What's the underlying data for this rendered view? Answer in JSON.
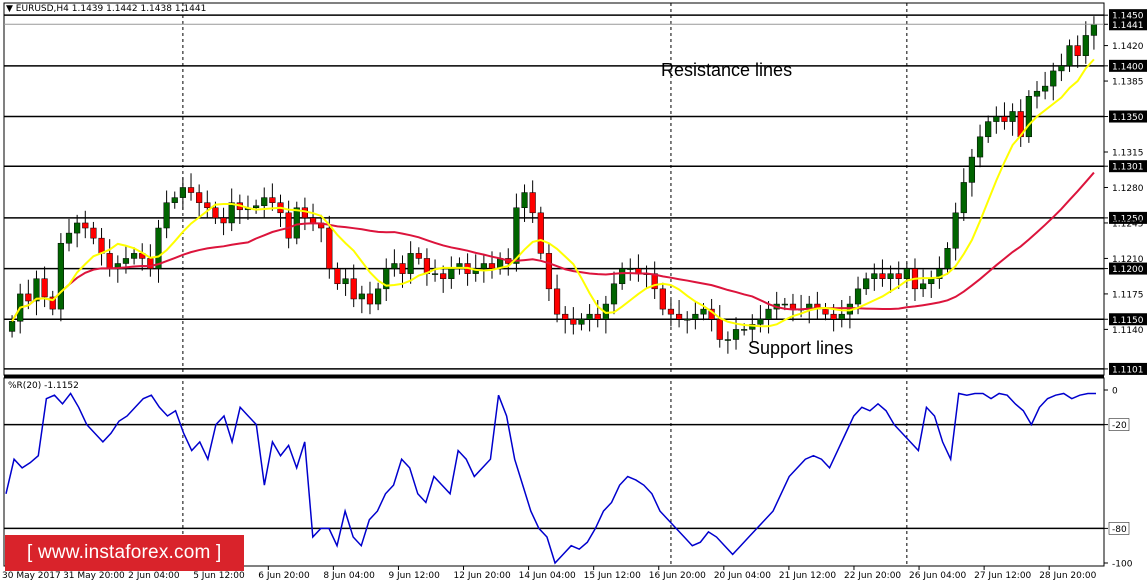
{
  "header": {
    "symbol_line": "EURUSD,H4  1.1439 1.1442 1.1438 1.1441",
    "indicator_line": "%R(20) -1.1152"
  },
  "annotations": {
    "resistance": "Resistance lines",
    "support": "Support lines"
  },
  "watermark": "[ www.instaforex.com ]",
  "colors": {
    "bull": "#006400",
    "bear": "#ff0000",
    "ma_fast": "#ffff00",
    "ma_slow": "#dc143c",
    "wpr": "#0000cd",
    "grid": "#000000",
    "background": "#ffffff"
  },
  "chart_data": [
    {
      "type": "candlestick",
      "title": "EURUSD,H4",
      "ylim": [
        1.1095,
        1.1462
      ],
      "y_ticks": [
        "1.1450",
        "1.1441",
        "1.1420",
        "1.1400",
        "1.1385",
        "1.1350",
        "1.1315",
        "1.1301",
        "1.1280",
        "1.1250",
        "1.1245",
        "1.1210",
        "1.1200",
        "1.1175",
        "1.1150",
        "1.1140",
        "1.1101"
      ],
      "highlighted_levels": [
        1.145,
        1.1441,
        1.14,
        1.135,
        1.1301,
        1.125,
        1.12,
        1.115,
        1.1101
      ],
      "horizontal_lines": [
        1.145,
        1.14,
        1.135,
        1.1301,
        1.125,
        1.12,
        1.115,
        1.1101
      ],
      "x_tick_labels": [
        "30 May 2017",
        "31 May 20:00",
        "2 Jun 04:00",
        "5 Jun 12:00",
        "6 Jun 20:00",
        "8 Jun 04:00",
        "9 Jun 12:00",
        "12 Jun 20:00",
        "14 Jun 04:00",
        "15 Jun 12:00",
        "16 Jun 20:00",
        "20 Jun 04:00",
        "21 Jun 12:00",
        "22 Jun 20:00",
        "26 Jun 04:00",
        "27 Jun 12:00",
        "28 Jun 20:00"
      ],
      "x_tick_bars": [
        0,
        8,
        16,
        24,
        32,
        40,
        48,
        56,
        64,
        72,
        80,
        88,
        96,
        104,
        112,
        120,
        128
      ],
      "period_separator_bars": [
        21,
        81,
        110
      ],
      "close_series": [
        1.1148,
        1.1175,
        1.1168,
        1.119,
        1.1172,
        1.116,
        1.1225,
        1.1235,
        1.1245,
        1.124,
        1.123,
        1.1215,
        1.12,
        1.1205,
        1.121,
        1.1215,
        1.121,
        1.12,
        1.124,
        1.1265,
        1.127,
        1.128,
        1.1275,
        1.1265,
        1.126,
        1.125,
        1.1245,
        1.1265,
        1.1258,
        1.126,
        1.1262,
        1.127,
        1.1265,
        1.1255,
        1.123,
        1.126,
        1.125,
        1.1245,
        1.124,
        1.12,
        1.1185,
        1.119,
        1.117,
        1.1175,
        1.1165,
        1.118,
        1.12,
        1.1205,
        1.1195,
        1.1215,
        1.121,
        1.1195,
        1.1195,
        1.119,
        1.12,
        1.1205,
        1.1195,
        1.12,
        1.1205,
        1.12,
        1.121,
        1.1205,
        1.126,
        1.1275,
        1.1255,
        1.1215,
        1.118,
        1.1155,
        1.115,
        1.1145,
        1.115,
        1.1155,
        1.115,
        1.1165,
        1.1185,
        1.12,
        1.12,
        1.1195,
        1.1195,
        1.118,
        1.116,
        1.1155,
        1.115,
        1.115,
        1.1155,
        1.116,
        1.115,
        1.113,
        1.113,
        1.114,
        1.114,
        1.1145,
        1.115,
        1.116,
        1.1165,
        1.1165,
        1.116,
        1.116,
        1.1165,
        1.116,
        1.1155,
        1.115,
        1.1155,
        1.1165,
        1.118,
        1.119,
        1.1195,
        1.119,
        1.1195,
        1.119,
        1.12,
        1.118,
        1.1185,
        1.119,
        1.12,
        1.122,
        1.1255,
        1.1285,
        1.131,
        1.133,
        1.1345,
        1.135,
        1.1345,
        1.1355,
        1.133,
        1.137,
        1.1375,
        1.138,
        1.1395,
        1.14,
        1.142,
        1.141,
        1.143,
        1.1441
      ],
      "ma_fast_name": "",
      "ma_slow_name": ""
    },
    {
      "type": "line",
      "title": "%R(20) -1.1152",
      "ylim": [
        -100,
        0
      ],
      "y_ticks": [
        "0",
        "-20",
        "-80",
        "-100"
      ],
      "levels": [
        -20,
        -80
      ],
      "series": [
        {
          "values": [
            -60,
            -40,
            -45,
            -42,
            -38,
            -5,
            -3,
            -8,
            -2,
            -10,
            -20,
            -25,
            -30,
            -25,
            -18,
            -15,
            -10,
            -5,
            -3,
            -10,
            -15,
            -12,
            -25,
            -35,
            -30,
            -40,
            -20,
            -15,
            -30,
            -10,
            -15,
            -20,
            -55,
            -30,
            -38,
            -32,
            -45,
            -30,
            -85,
            -80,
            -80,
            -90,
            -70,
            -85,
            -90,
            -75,
            -70,
            -60,
            -55,
            -40,
            -45,
            -60,
            -65,
            -50,
            -55,
            -60,
            -35,
            -40,
            -50,
            -45,
            -40,
            -3,
            -15,
            -40,
            -55,
            -70,
            -80,
            -85,
            -100,
            -95,
            -90,
            -92,
            -88,
            -80,
            -70,
            -65,
            -55,
            -50,
            -52,
            -55,
            -60,
            -70,
            -75,
            -80,
            -85,
            -90,
            -88,
            -82,
            -85,
            -90,
            -95,
            -90,
            -85,
            -80,
            -75,
            -70,
            -60,
            -50,
            -45,
            -40,
            -38,
            -40,
            -45,
            -35,
            -25,
            -15,
            -10,
            -12,
            -8,
            -12,
            -20,
            -25,
            -30,
            -35,
            -10,
            -15,
            -30,
            -40,
            -2,
            -3,
            -2,
            -2,
            -5,
            -2,
            -3,
            -8,
            -12,
            -20,
            -10,
            -5,
            -3,
            -2,
            -5,
            -3,
            -2,
            -2
          ]
        }
      ]
    }
  ]
}
